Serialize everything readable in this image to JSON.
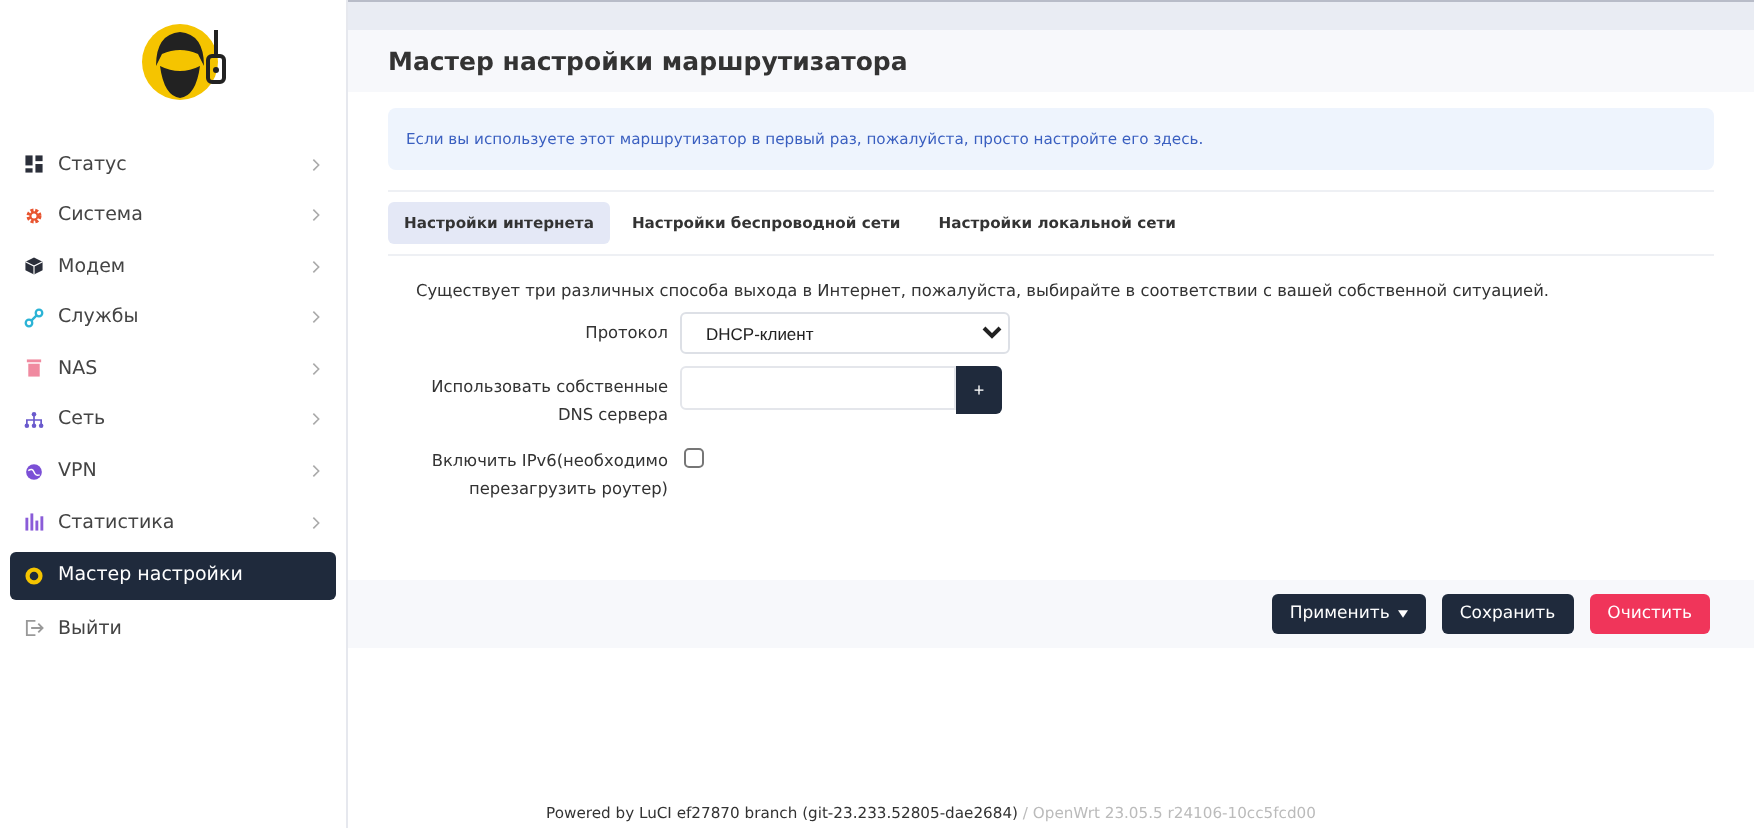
{
  "sidebar": {
    "items": [
      {
        "label": "Статус",
        "selected": false,
        "has_submenu": true
      },
      {
        "label": "Система",
        "selected": false,
        "has_submenu": true
      },
      {
        "label": "Модем",
        "selected": false,
        "has_submenu": true
      },
      {
        "label": "Службы",
        "selected": false,
        "has_submenu": true
      },
      {
        "label": "NAS",
        "selected": false,
        "has_submenu": true
      },
      {
        "label": "Сеть",
        "selected": false,
        "has_submenu": true
      },
      {
        "label": "VPN",
        "selected": false,
        "has_submenu": true
      },
      {
        "label": "Статистика",
        "selected": false,
        "has_submenu": true
      },
      {
        "label": "Мастер настройки",
        "selected": true,
        "has_submenu": false
      },
      {
        "label": "Выйти",
        "selected": false,
        "has_submenu": false
      }
    ]
  },
  "page_title": "Мастер настройки маршрутизатора",
  "notice": "Если вы используете этот маршрутизатор в первый раз, пожалуйста, просто настройте его здесь.",
  "tabs": [
    {
      "label": "Настройки интернета",
      "selected": true
    },
    {
      "label": "Настройки беспроводной сети",
      "selected": false
    },
    {
      "label": "Настройки локальной сети",
      "selected": false
    }
  ],
  "description": "Существует три различных способа выхода в Интернет, пожалуйста, выбирайте в соответствии с вашей собственной ситуацией.",
  "fields": [
    {
      "kind": "select",
      "label": "Протокол",
      "value": "DHCP-клиент"
    },
    {
      "kind": "dynlist",
      "label": "Использовать собственные DNS сервера",
      "button": "+"
    },
    {
      "kind": "checkbox",
      "label": "Включить IPv6(необходимо перезагрузить роутер)",
      "checked": false
    }
  ],
  "actions": [
    {
      "label": "Применить",
      "kind": "dropdown"
    },
    {
      "label": "Сохранить",
      "kind": "primary"
    },
    {
      "label": "Очистить",
      "kind": "danger"
    }
  ],
  "footer": {
    "powered": "Powered by LuCI ef27870 branch (git-23.233.52805-dae2684)",
    "version": "/ OpenWrt 23.05.5 r24106-10cc5fcd00"
  }
}
